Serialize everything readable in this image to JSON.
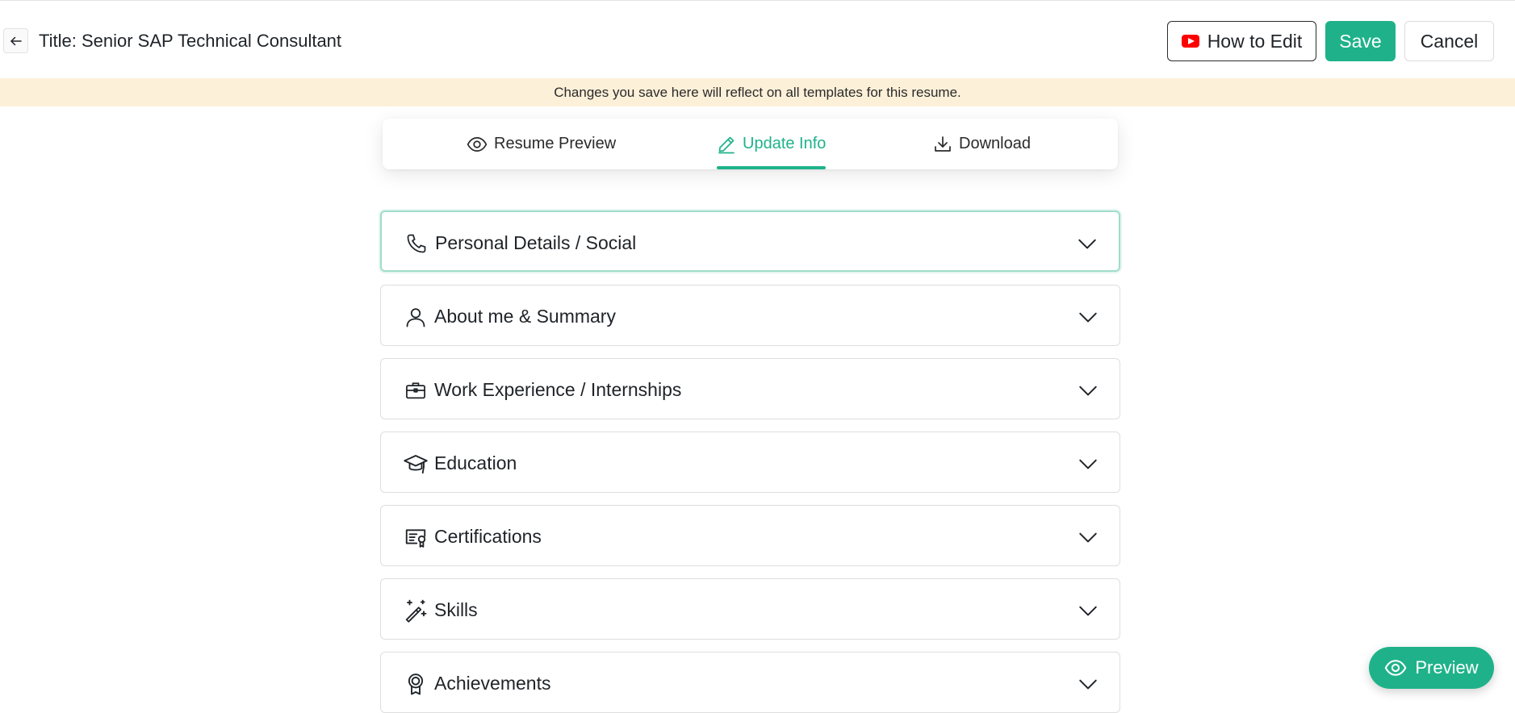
{
  "header": {
    "title": "Title: Senior SAP Technical Consultant",
    "back_icon": "arrow-left-icon",
    "how_to_edit_label": "How to Edit",
    "how_to_edit_icon": "youtube-icon",
    "save_label": "Save",
    "cancel_label": "Cancel"
  },
  "notice": {
    "text": "Changes you save here will reflect on all templates for this resume."
  },
  "tabs": [
    {
      "label": "Resume Preview",
      "icon": "eye-icon",
      "active": false
    },
    {
      "label": "Update Info",
      "icon": "pencil-icon",
      "active": true
    },
    {
      "label": "Download",
      "icon": "download-icon",
      "active": false
    }
  ],
  "sections": [
    {
      "label": "Personal Details / Social",
      "icon": "phone-icon",
      "active": true
    },
    {
      "label": "About me & Summary",
      "icon": "user-icon",
      "active": false
    },
    {
      "label": "Work Experience / Internships",
      "icon": "briefcase-icon",
      "active": false
    },
    {
      "label": "Education",
      "icon": "graduation-cap-icon",
      "active": false
    },
    {
      "label": "Certifications",
      "icon": "certificate-icon",
      "active": false
    },
    {
      "label": "Skills",
      "icon": "magic-wand-icon",
      "active": false
    },
    {
      "label": "Achievements",
      "icon": "award-icon",
      "active": false
    }
  ],
  "float_preview": {
    "label": "Preview",
    "icon": "eye-icon"
  },
  "colors": {
    "accent": "#1fb28a",
    "notice_bg": "#fdf0d9",
    "youtube_red": "#ff0000"
  }
}
